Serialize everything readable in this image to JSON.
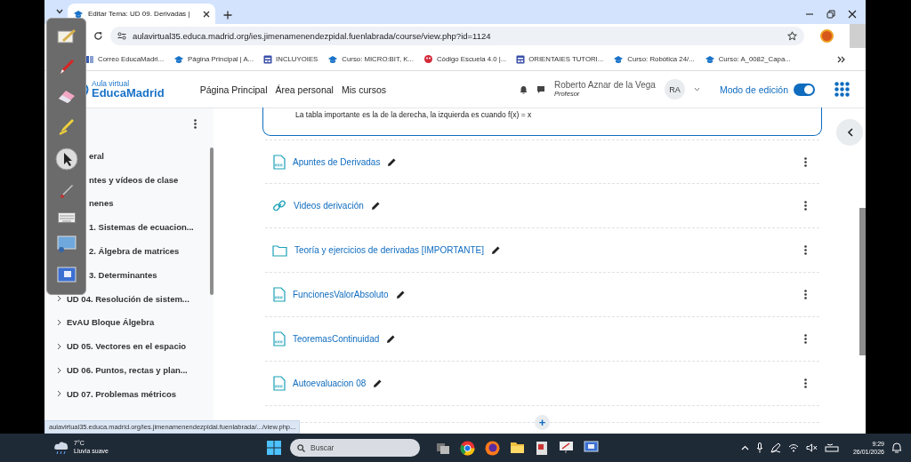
{
  "browser": {
    "tab": {
      "title": "Editar Tema: UD 09. Derivadas |"
    },
    "address": "aulavirtual35.educa.madrid.org/ies.jimenamenendezpidal.fuenlabrada/course/view.php?id=1124",
    "bookmarks": [
      {
        "kind": "mail",
        "label": "Correo EducaMadri..."
      },
      {
        "kind": "course",
        "label": "Página Principal | A..."
      },
      {
        "kind": "form",
        "label": "INCLUYOIES"
      },
      {
        "kind": "course",
        "label": "Curso: MICRO:BIT, K..."
      },
      {
        "kind": "game",
        "label": "Código Escuela 4.0 |..."
      },
      {
        "kind": "form",
        "label": "ORIENTAIES TUTORI..."
      },
      {
        "kind": "course",
        "label": "Curso: Robótica 24/..."
      },
      {
        "kind": "course",
        "label": "Curso: A_0082_Capa..."
      }
    ]
  },
  "header": {
    "logo_top": "Aula virtual",
    "logo_main": "EducaMadrid",
    "nav": [
      "Página Principal",
      "Área personal",
      "Mis cursos"
    ],
    "user": {
      "name": "Roberto Aznar de la Vega",
      "role": "Profesor",
      "initials": "RA"
    },
    "edit_mode": {
      "label": "Modo de edición",
      "on": true
    }
  },
  "sidebar": {
    "items": [
      {
        "kind": "covered",
        "label": "eral"
      },
      {
        "kind": "covered",
        "label": "ntes y vídeos de clase"
      },
      {
        "kind": "covered",
        "label": "nenes"
      },
      {
        "kind": "covered",
        "label": "1. Sistemas de ecuacion..."
      },
      {
        "kind": "covered",
        "label": "2. Álgebra de matrices"
      },
      {
        "kind": "covered",
        "label": "3. Determinantes"
      },
      {
        "kind": "full",
        "label": "UD 04. Resolución de sistem..."
      },
      {
        "kind": "full",
        "label": "EvAU Bloque Álgebra"
      },
      {
        "kind": "full",
        "label": "UD 05. Vectores en el espacio"
      },
      {
        "kind": "full",
        "label": "UD 06. Puntos, rectas y plan..."
      },
      {
        "kind": "full",
        "label": "UD 07. Problemas métricos"
      }
    ]
  },
  "section_note": "La tabla importante es la de la derecha, la izquierda es cuando f(x) = x",
  "activities": [
    {
      "kind": "pdf",
      "title": "Apuntes de Derivadas"
    },
    {
      "kind": "link",
      "title": "Videos derivación"
    },
    {
      "kind": "folder",
      "title": "Teoría y ejercicios de derivadas [IMPORTANTE]"
    },
    {
      "kind": "pdf",
      "title": "FuncionesValorAbsoluto"
    },
    {
      "kind": "pdf",
      "title": "TeoremasContinuidad"
    },
    {
      "kind": "pdf",
      "title": "Autoevaluacion 08"
    }
  ],
  "add_button": "+",
  "status_url": "aulavirtual35.educa.madrid.org/ies.jimenamenendezpidal.fuenlabrada/.../view.php...",
  "taskbar": {
    "weather": {
      "temp": "7°C",
      "desc": "Lluvia suave"
    },
    "search_placeholder": "Buscar",
    "time": "9:29",
    "date": "26/01/2026"
  }
}
